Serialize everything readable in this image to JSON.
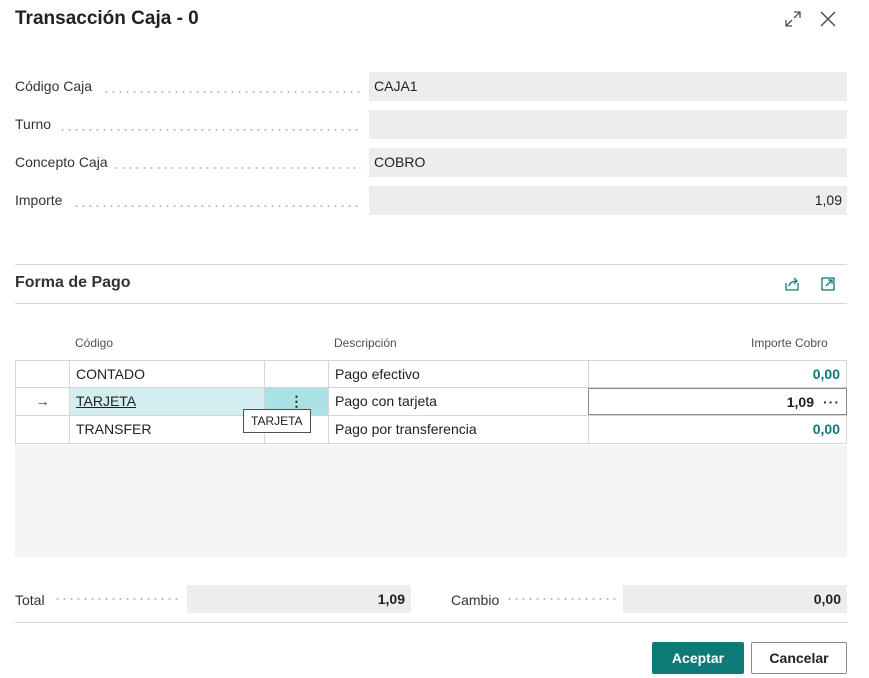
{
  "dialog": {
    "title": "Transacción Caja - 0"
  },
  "fields": [
    {
      "label": "Código Caja",
      "value": "CAJA1"
    },
    {
      "label": "Turno",
      "value": ""
    },
    {
      "label": "Concepto Caja",
      "value": "COBRO"
    },
    {
      "label": "Importe",
      "value": "1,09"
    }
  ],
  "payment_section": {
    "title": "Forma de Pago",
    "columns": {
      "codigo": "Código",
      "descripcion": "Descripción",
      "importe": "Importe Cobro"
    },
    "rows": [
      {
        "indicator": "",
        "codigo": "CONTADO",
        "menu": "",
        "descripcion": "Pago efectivo",
        "importe": "0,00"
      },
      {
        "indicator": "→",
        "codigo": "TARJETA",
        "menu": "⋮",
        "descripcion": "Pago con tarjeta",
        "importe": "1,09",
        "more": "···"
      },
      {
        "indicator": "",
        "codigo": "TRANSFER",
        "menu": "",
        "descripcion": "Pago por transferencia",
        "importe": "0,00"
      }
    ],
    "tooltip": "TARJETA"
  },
  "totals": {
    "total_label": "Total",
    "total_value": "1,09",
    "cambio_label": "Cambio",
    "cambio_value": "0,00"
  },
  "buttons": {
    "accept": "Aceptar",
    "cancel": "Cancelar"
  },
  "colors": {
    "accent": "#0d7a77",
    "field_bg": "#ededed",
    "active_cell": "#d3eef0"
  }
}
